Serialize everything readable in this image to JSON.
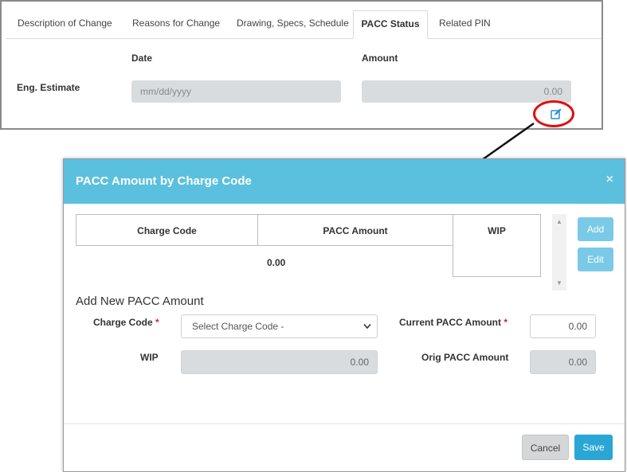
{
  "tabs": [
    {
      "label": "Description of Change"
    },
    {
      "label": "Reasons for Change"
    },
    {
      "label": "Drawing, Specs, Schedule"
    },
    {
      "label": "PACC Status"
    },
    {
      "label": "Related PIN"
    }
  ],
  "estimate": {
    "date_header": "Date",
    "amount_header": "Amount",
    "row_label": "Eng. Estimate",
    "date_placeholder": "mm/dd/yyyy",
    "amount_value": "0.00"
  },
  "modal": {
    "title": "PACC Amount by Charge Code",
    "close": "×",
    "table": {
      "headers": [
        "Charge Code",
        "PACC Amount",
        "WIP"
      ],
      "total_amount": "0.00"
    },
    "add_button": "Add",
    "edit_button": "Edit",
    "section_title": "Add New PACC Amount",
    "charge_code_label": "Charge Code",
    "charge_code_select": "Select Charge Code -",
    "current_pacc_label": "Current PACC Amount",
    "current_pacc_value": "0.00",
    "wip_label": "WIP",
    "wip_value": "0.00",
    "orig_pacc_label": "Orig PACC Amount",
    "orig_pacc_value": "0.00",
    "required_mark": "*",
    "cancel_button": "Cancel",
    "save_button": "Save"
  },
  "colors": {
    "modal_header": "#5bc0de",
    "side_buttons": "#7ac9e6",
    "save_button": "#2aa6d5",
    "callout": "#e01010"
  }
}
